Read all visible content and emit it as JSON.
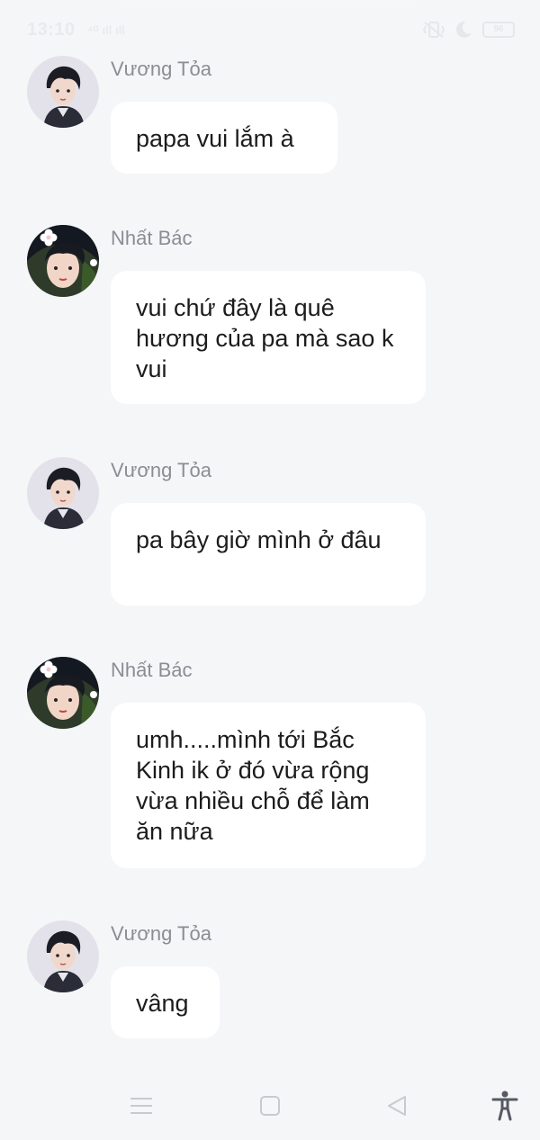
{
  "status_bar": {
    "time": "13:10",
    "signal": "⁴ᴳ ıll ıll",
    "battery": "96"
  },
  "messages": [
    {
      "sender": "Vương Tỏa",
      "avatar": "avatar-vuong-toa",
      "text": "papa vui lắm à"
    },
    {
      "sender": "Nhất Bác",
      "avatar": "avatar-nhat-bac",
      "text": "vui chứ đây là quê hương của pa mà sao k vui"
    },
    {
      "sender": "Vương Tỏa",
      "avatar": "avatar-vuong-toa",
      "text": "pa bây giờ mình ở đâu"
    },
    {
      "sender": "Nhất Bác",
      "avatar": "avatar-nhat-bac",
      "text": "umh.....mình tới Bắc Kinh ik ở đó vừa rộng vừa nhiều chỗ để làm ăn nữa"
    },
    {
      "sender": "Vương Tỏa",
      "avatar": "avatar-vuong-toa",
      "text": "vâng"
    }
  ],
  "nav_bar": {
    "buttons": [
      "menu-icon",
      "home-icon",
      "back-icon",
      "accessibility-icon"
    ]
  },
  "colors": {
    "background": "#f5f6f8",
    "bubble": "#ffffff",
    "sender_name": "#8b8d93",
    "message_text": "#1c1c1e"
  }
}
